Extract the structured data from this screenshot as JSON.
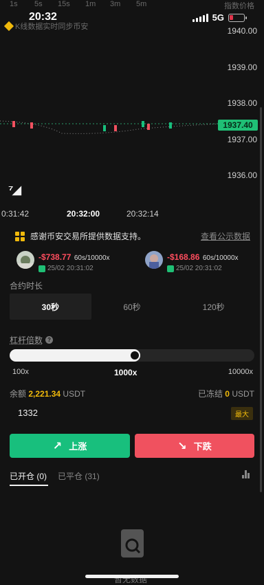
{
  "timeframes": [
    "1s",
    "5s",
    "15s",
    "1m",
    "3m",
    "5m"
  ],
  "top_right_label": "指数价格",
  "status": {
    "time": "20:32",
    "network": "5G"
  },
  "source_note": "K线数据实时同步币安",
  "price_axis": [
    "1940.00",
    "1939.00",
    "1938.00",
    "1937.00",
    "1936.00"
  ],
  "current_price": "1937.40",
  "time_axis": [
    "0:31:42",
    "20:32:00",
    "20:32:14"
  ],
  "notice": {
    "text": "感谢币安交易所提供数据支持。",
    "link": "查看公示数据"
  },
  "trades": [
    {
      "amount": "-$738.77",
      "spec": "60s/10000x",
      "date": "25/02 20:31:02"
    },
    {
      "amount": "-$168.86",
      "spec": "60s/10000x",
      "date": "25/02 20:31:02"
    }
  ],
  "duration": {
    "label": "合约时长",
    "options": [
      "30秒",
      "60秒",
      "120秒"
    ],
    "selected": "30秒"
  },
  "leverage": {
    "label": "杠杆倍数",
    "ticks": [
      "100x",
      "1000x",
      "10000x"
    ],
    "value": "1000x",
    "fraction": 0.51
  },
  "balance": {
    "label": "余额",
    "value": "2,221.34",
    "unit": "USDT"
  },
  "frozen": {
    "label": "已冻结",
    "value": "0",
    "unit": "USDT"
  },
  "amount_input": {
    "value": "1332"
  },
  "max_label": "最大",
  "buttons": {
    "up": "上涨",
    "down": "下跌"
  },
  "positions": {
    "open_label": "已开仓",
    "open_count": "(0)",
    "closed_label": "已平仓",
    "closed_count": "(31)"
  },
  "empty_text": "暂无数据",
  "colors": {
    "up": "#18bf7d",
    "down": "#f0515f",
    "accent": "#f0b90b",
    "background": "#131313"
  },
  "icons": [
    "signal-icon",
    "battery-icon",
    "binance-logo-icon",
    "tradingview-logo-icon",
    "trend-up-icon",
    "help-icon",
    "arrow-up-right-icon",
    "arrow-down-right-icon",
    "bar-chart-icon",
    "search-file-icon"
  ]
}
